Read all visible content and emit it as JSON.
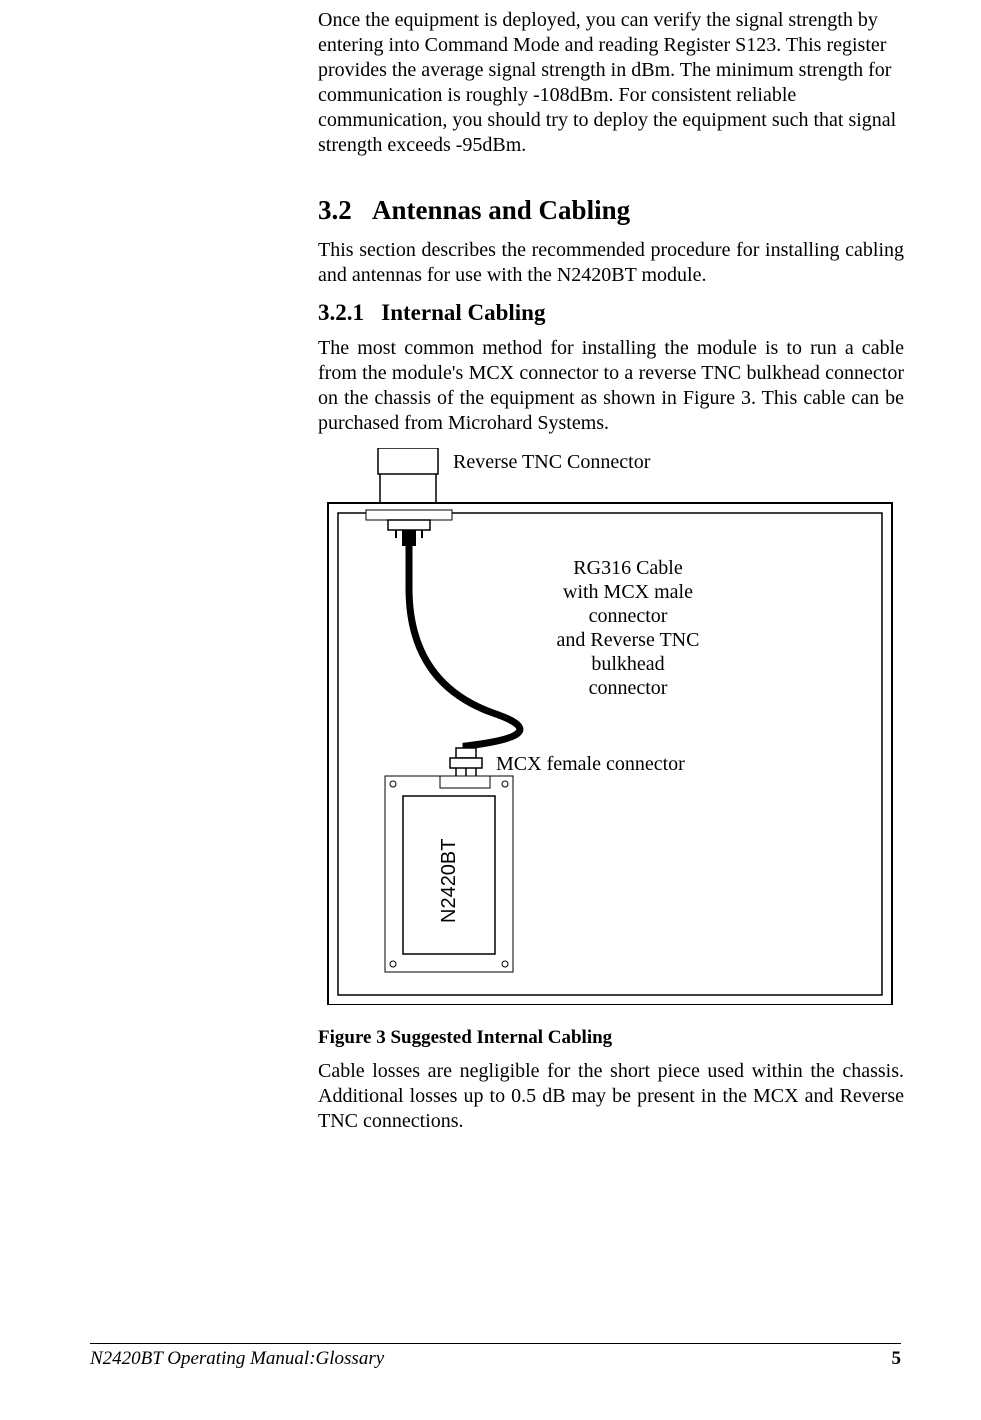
{
  "intro_para": "Once the equipment is deployed, you can verify the signal strength by entering into Command Mode and reading Register S123.  This register provides the average signal strength in dBm.  The minimum strength for communication is roughly -108dBm.  For consistent reliable communication, you should try to deploy the equipment such that signal strength exceeds -95dBm.",
  "h2_number": "3.2",
  "h2_title": "Antennas and Cabling",
  "h2_para": "This section describes the recommended procedure for installing cabling and antennas for use with the N2420BT module.",
  "h3_number": "3.2.1",
  "h3_title": "Internal Cabling",
  "h3_para": "The most common method for installing the module is to run a cable from the module's MCX connector to a reverse TNC bulkhead connector on the chassis of the equipment as shown in Figure 3.  This cable can be purchased from Microhard Systems.",
  "figure": {
    "label_tnc": "Reverse TNC Connector",
    "label_cable_l1": "RG316 Cable",
    "label_cable_l2": "with MCX male",
    "label_cable_l3": "connector",
    "label_cable_l4": "and Reverse TNC",
    "label_cable_l5": "bulkhead",
    "label_cable_l6": "connector",
    "label_mcx": "MCX female connector",
    "module_label": "N2420BT",
    "caption": "Figure 3 Suggested Internal Cabling"
  },
  "closing_para": "Cable losses are negligible for the short piece used within the chassis. Additional losses up to 0.5 dB may be present in the MCX and Reverse TNC connections.",
  "footer_left": "N2420BT Operating Manual:Glossary",
  "footer_page": "5"
}
